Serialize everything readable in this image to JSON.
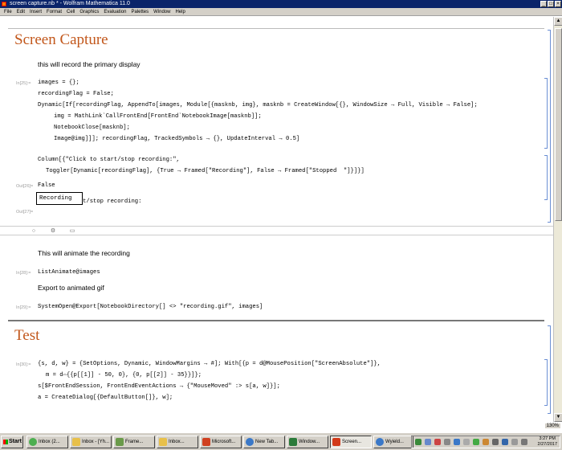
{
  "window": {
    "title": "screen capture.nb * - Wolfram Mathematica 11.0"
  },
  "menu": [
    "File",
    "Edit",
    "Insert",
    "Format",
    "Cell",
    "Graphics",
    "Evaluation",
    "Palettes",
    "Window",
    "Help"
  ],
  "sections": {
    "screen_capture": {
      "title": "Screen Capture",
      "intro": "this will record the primary display",
      "in_label_25": "In[25]:=",
      "code": [
        "images = {};",
        "recordingFlag = False;",
        "Dynamic[If[recordingFlag, AppendTo[images, Module[{masknb, img}, masknb = CreateWindow[{}, WindowSize → Full, Visible → False];",
        "img = MathLink`CallFrontEnd[FrontEnd`NotebookImage[masknb]];",
        "NotebookClose[masknb];",
        "Image@img]]]; recordingFlag, TrackedSymbols → {}, UpdateInterval → 0.5]"
      ],
      "column_code": [
        "Column[{\"Click to start/stop recording:\",",
        "Toggler[Dynamic[recordingFlag], {True → Framed[\"Recording\"], False → Framed[\"Stopped  \"]}]}]"
      ],
      "out_label_26": "Out[26]=",
      "out_26": "False",
      "out_label_27": "Out[27]=",
      "out_27_text": "Click to start/stop recording:",
      "recording_button": "Recording"
    },
    "animate": {
      "text": "This will animate the recording",
      "in_label_28": "In[28]:=",
      "code": "ListAnimate@images",
      "export_text": "Export to animated gif",
      "in_label_29": "In[29]:=",
      "export_code": "SystemOpen@Export[NotebookDirectory[] <> \"recording.gif\", images]"
    },
    "test": {
      "title": "Test",
      "in_label_30": "In[30]:=",
      "code": [
        "{s, d, w} = {SetOptions, Dynamic, WindowMargins → #]; With[{p = d@MousePosition[\"ScreenAbsolute\"]},",
        "m = d⇔{{p[[1]] - 50, 0}, {0, p[[2]] - 35}}]};",
        "s[$FrontEndSession, FrontEndEventActions → {\"MouseMoved\" :> s[a, w]}];",
        "a = CreateDialog[{DefaultButton[]}, w];"
      ]
    }
  },
  "status": {
    "zoom": "130%"
  },
  "taskbar": {
    "start": "Start",
    "tasks": [
      "Inbox (2...",
      "Inbox - [Yh...",
      "Frame...",
      "Inbox...",
      "Microsoft...",
      "New Tab...",
      "Window...",
      "Screen...",
      "Wyield..."
    ],
    "clock_time": "3:27 PM",
    "clock_date": "2/27/2017"
  },
  "colors": {
    "title_orange": "#c2571b",
    "bracket_blue": "#6b8fd4",
    "titlebar_blue": "#0a246a"
  }
}
